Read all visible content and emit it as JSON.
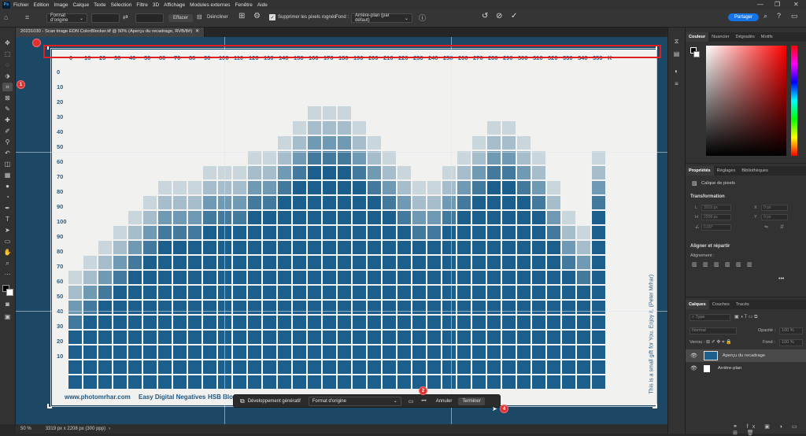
{
  "menu": {
    "logo": "Ps",
    "items": [
      "Fichier",
      "Edition",
      "Image",
      "Calque",
      "Texte",
      "Sélection",
      "Filtre",
      "3D",
      "Affichage",
      "Modules externes",
      "Fenêtre",
      "Aide"
    ]
  },
  "window_controls": {
    "minimize": "—",
    "maximize": "❐",
    "close": "✕"
  },
  "options_bar": {
    "ratio_select": "Format d'origine",
    "clear_label": "Effacer",
    "straighten_label": "Déincliner",
    "delete_cropped_label": "Supprimer les pixels rognés",
    "delete_cropped_checked": true,
    "fill_label": "Fond :",
    "fill_select": "Arrière-plan (par défaut)",
    "share_label": "Partager"
  },
  "document_tab": {
    "title": "20231030 - Scan tirage EDN ColorBlocker.tif @ 50% (Aperçu du recadrage, RVB/8#)"
  },
  "artwork": {
    "top_labels": [
      "0",
      "10",
      "20",
      "30",
      "40",
      "50",
      "60",
      "70",
      "80",
      "90",
      "100",
      "110",
      "120",
      "130",
      "140",
      "150",
      "160",
      "170",
      "180",
      "190",
      "200",
      "210",
      "220",
      "230",
      "240",
      "250",
      "260",
      "270",
      "280",
      "290",
      "300",
      "310",
      "320",
      "330",
      "340",
      "350",
      "K"
    ],
    "left_labels": [
      "0",
      "10",
      "20",
      "30",
      "40",
      "50",
      "60",
      "70",
      "80",
      "90",
      "100",
      "90",
      "80",
      "70",
      "60",
      "50",
      "40",
      "30",
      "20",
      "10"
    ],
    "footer_url": "www.photomrhar.com",
    "footer_title": "Easy Digital Negatives",
    "footer_hsb": "HSB Bloc",
    "side_text": "This is a small gift for You. Enjoy it. (Peter Mrhar)",
    "column_rows": [
      8,
      9,
      10,
      11,
      12,
      13,
      14,
      14,
      14,
      15,
      15,
      15,
      16,
      16,
      17,
      18,
      19,
      19,
      19,
      18,
      17,
      16,
      15,
      14,
      14,
      15,
      16,
      17,
      18,
      18,
      17,
      16,
      14,
      12,
      11,
      16
    ],
    "base_color": "#1c5f8c"
  },
  "context_bar": {
    "generative_label": "Développement génératif",
    "ratio_select": "Format d'origine",
    "more_label": "•••",
    "cancel_label": "Annuler",
    "done_label": "Terminer"
  },
  "annotations": {
    "b1": "1",
    "b2": "2",
    "b4": "4"
  },
  "status": {
    "zoom": "50 %",
    "info": "3319 px x 2208 px (300 ppp)"
  },
  "color_panel": {
    "tabs": [
      "Couleur",
      "Nuancier",
      "Dégradés",
      "Motifs"
    ]
  },
  "properties_panel": {
    "tabs": [
      "Propriétés",
      "Réglages",
      "Bibliothèques"
    ],
    "layer_type": "Calque de pixels",
    "transform_title": "Transformation",
    "w_label": "L",
    "w_val": "3319 px",
    "h_label": "H",
    "h_val": "2208 px",
    "x_label": "X",
    "x_val": "0 px",
    "y_label": "Y",
    "y_val": "0 px",
    "angle_val": "0,00°",
    "align_title": "Aligner et répartir",
    "align_sub": "Alignement :"
  },
  "layers_panel": {
    "tabs": [
      "Calques",
      "Couches",
      "Tracés"
    ],
    "search_placeholder": "Type",
    "blend_mode": "Normal",
    "opacity_label": "Opacité :",
    "opacity_val": "100 %",
    "lock_label": "Verrou :",
    "fill_label": "Fond :",
    "fill_val": "100 %",
    "layers": [
      {
        "name": "Aperçu du recadrage",
        "selected": true
      },
      {
        "name": "Arrière-plan",
        "selected": false
      }
    ]
  }
}
